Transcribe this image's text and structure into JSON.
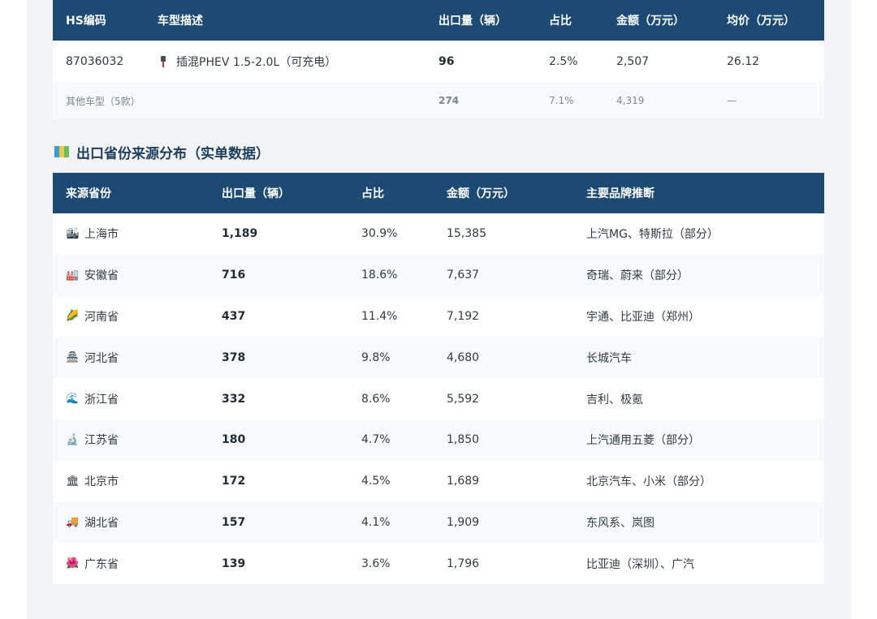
{
  "top_table": {
    "headers": [
      "HS编码",
      "车型描述",
      "出口量（辆）",
      "占比",
      "金额（万元）",
      "均价（万元）"
    ],
    "main_row": {
      "hs_code": "87036032",
      "icon": "plug-icon",
      "description": "插混PHEV 1.5-2.0L（可充电）",
      "volume": "96",
      "share": "2.5%",
      "amount": "2,507",
      "avg_price": "26.12"
    },
    "other_row": {
      "label": "其他车型（5款）",
      "volume": "274",
      "share": "7.1%",
      "amount": "4,319",
      "avg_price": "—"
    }
  },
  "province_section": {
    "title": "出口省份来源分布（实单数据）",
    "title_icon": "map-icon",
    "headers": [
      "来源省份",
      "出口量（辆）",
      "占比",
      "金额（万元）",
      "主要品牌推断"
    ],
    "rows": [
      {
        "icon": "cityscape-icon",
        "glyph": "🏙",
        "province": "上海市",
        "volume": "1,189",
        "share": "30.9%",
        "amount": "15,385",
        "brands": "上汽MG、特斯拉（部分）"
      },
      {
        "icon": "factory-icon",
        "glyph": "🏭",
        "province": "安徽省",
        "volume": "716",
        "share": "18.6%",
        "amount": "7,637",
        "brands": "奇瑞、蔚来（部分）"
      },
      {
        "icon": "corn-icon",
        "glyph": "🌽",
        "province": "河南省",
        "volume": "437",
        "share": "11.4%",
        "amount": "7,192",
        "brands": "宇通、比亚迪（郑州）"
      },
      {
        "icon": "great-wall-icon",
        "glyph": "🏯",
        "province": "河北省",
        "volume": "378",
        "share": "9.8%",
        "amount": "4,680",
        "brands": "长城汽车"
      },
      {
        "icon": "wave-icon",
        "glyph": "🌊",
        "province": "浙江省",
        "volume": "332",
        "share": "8.6%",
        "amount": "5,592",
        "brands": "吉利、极氪"
      },
      {
        "icon": "microscope-icon",
        "glyph": "🔬",
        "province": "江苏省",
        "volume": "180",
        "share": "4.7%",
        "amount": "1,850",
        "brands": "上汽通用五菱（部分）"
      },
      {
        "icon": "classical-building-icon",
        "glyph": "🏛",
        "province": "北京市",
        "volume": "172",
        "share": "4.5%",
        "amount": "1,689",
        "brands": "北京汽车、小米（部分）"
      },
      {
        "icon": "truck-icon",
        "glyph": "🚚",
        "province": "湖北省",
        "volume": "157",
        "share": "4.1%",
        "amount": "1,909",
        "brands": "东风系、岚图"
      },
      {
        "icon": "flower-icon",
        "glyph": "🌺",
        "province": "广东省",
        "volume": "139",
        "share": "3.6%",
        "amount": "1,796",
        "brands": "比亚迪（深圳）、广汽"
      }
    ]
  },
  "colors": {
    "header_bg": "#1d4a72",
    "panel_bg": "#f1f3f7",
    "alt_row_bg": "#f7f9fb",
    "title_color": "#1d3e5c"
  }
}
